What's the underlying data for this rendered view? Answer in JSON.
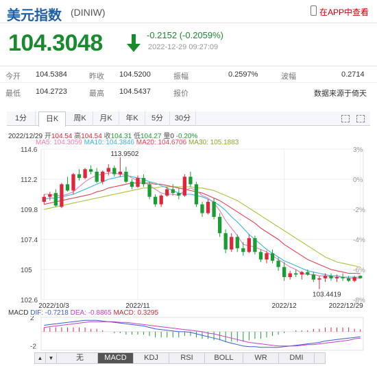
{
  "header": {
    "title": "美元指数",
    "code": "(DINIW)",
    "app_link": "在APP中查看"
  },
  "quote": {
    "price": "104.3048",
    "change": "-0.2152 (-0.2059%)",
    "time": "2022-12-29 09:27:09",
    "direction": "down",
    "color": "#1a8a2f"
  },
  "stats": {
    "open_label": "今开",
    "open": "104.5384",
    "prev_label": "昨收",
    "prev": "104.5200",
    "amp_label": "振幅",
    "amp": "0.2597%",
    "wave_label": "波幅",
    "wave": "0.2714",
    "low_label": "最低",
    "low": "104.2723",
    "high_label": "最高",
    "high": "104.5437",
    "report_label": "报价",
    "source": "数据来源于倚天"
  },
  "tabs": [
    "1分",
    "日K",
    "周K",
    "月K",
    "年K",
    "5分",
    "30分"
  ],
  "active_tab": "日K",
  "kinfo": {
    "date": "2022/12/29",
    "open_label": "开",
    "open": "104.54",
    "high_label": "高",
    "high": "104.54",
    "close_label": "收",
    "close": "104.31",
    "low_label": "低",
    "low": "104.27",
    "chg_label": "量",
    "chg": "0",
    "pct": "-0.20%"
  },
  "ma": {
    "ma5": "MA5: 104.3059",
    "ma10": "MA10: 104.3846",
    "ma20": "MA20: 104.6706",
    "ma30": "MA30: 105.1883"
  },
  "ma_colors": {
    "ma5": "#e87db8",
    "ma10": "#39b5e0",
    "ma20": "#e04055",
    "ma30": "#a8c23a"
  },
  "macd": {
    "label": "MACD",
    "dif": "DIF: -0.7218",
    "dea": "DEA: -0.8865",
    "macd": "MACD: 0.3295"
  },
  "buttons": [
    "无",
    "MACD",
    "KDJ",
    "RSI",
    "BOLL",
    "WR",
    "DMI"
  ],
  "active_button": "MACD",
  "chart_data": {
    "type": "candlestick",
    "y_ticks": [
      "114.6",
      "112.2",
      "109.8",
      "107.4",
      "105",
      "102.6"
    ],
    "pct_ticks": [
      "3%",
      "0%",
      "-2%",
      "-4%",
      "-6%",
      "-8%"
    ],
    "x_ticks": [
      "2022/10/3",
      "2022/11",
      "2022/12",
      "2022/12/29"
    ],
    "max_label": "113.9502",
    "min_label": "103.4419",
    "ylim": [
      102.6,
      114.6
    ],
    "up_color": "#e0263a",
    "down_color": "#1a9e33",
    "candles": [
      [
        110.4,
        111.0,
        110.2,
        110.8
      ],
      [
        110.8,
        111.2,
        110.5,
        111.0
      ],
      [
        111.1,
        111.4,
        110.0,
        110.1
      ],
      [
        110.0,
        111.9,
        109.9,
        111.8
      ],
      [
        111.8,
        112.4,
        111.2,
        111.3
      ],
      [
        111.3,
        112.7,
        111.0,
        112.6
      ],
      [
        112.6,
        113.0,
        112.1,
        112.3
      ],
      [
        112.3,
        113.1,
        112.2,
        113.0
      ],
      [
        113.0,
        113.3,
        112.6,
        112.8
      ],
      [
        112.8,
        113.1,
        111.9,
        112.0
      ],
      [
        112.0,
        112.9,
        111.8,
        112.8
      ],
      [
        112.8,
        113.4,
        112.5,
        113.1
      ],
      [
        113.1,
        113.3,
        112.4,
        112.6
      ],
      [
        112.6,
        113.95,
        112.4,
        112.8
      ],
      [
        112.8,
        113.2,
        111.9,
        112.0
      ],
      [
        112.0,
        112.2,
        111.4,
        111.6
      ],
      [
        111.6,
        112.5,
        111.5,
        112.3
      ],
      [
        112.3,
        112.6,
        111.6,
        111.8
      ],
      [
        111.8,
        112.0,
        110.6,
        110.8
      ],
      [
        110.8,
        111.0,
        110.0,
        110.2
      ],
      [
        110.2,
        111.0,
        110.0,
        110.9
      ],
      [
        110.9,
        111.6,
        110.8,
        111.4
      ],
      [
        111.4,
        111.8,
        110.9,
        111.1
      ],
      [
        111.1,
        111.5,
        110.6,
        110.9
      ],
      [
        110.9,
        112.6,
        110.8,
        112.4
      ],
      [
        112.4,
        112.8,
        111.6,
        111.8
      ],
      [
        111.8,
        112.0,
        110.0,
        110.2
      ],
      [
        110.2,
        110.4,
        109.2,
        109.5
      ],
      [
        109.5,
        110.6,
        109.4,
        110.4
      ],
      [
        110.4,
        110.7,
        109.0,
        109.2
      ],
      [
        109.2,
        109.5,
        107.6,
        107.9
      ],
      [
        107.9,
        108.2,
        106.3,
        106.6
      ],
      [
        106.6,
        107.9,
        106.4,
        107.6
      ],
      [
        107.6,
        107.8,
        106.4,
        106.7
      ],
      [
        106.7,
        107.2,
        106.1,
        106.4
      ],
      [
        106.4,
        107.8,
        106.3,
        107.5
      ],
      [
        107.5,
        107.7,
        106.2,
        106.4
      ],
      [
        106.4,
        106.6,
        105.6,
        105.8
      ],
      [
        105.8,
        106.5,
        105.5,
        106.3
      ],
      [
        106.3,
        106.6,
        105.5,
        105.7
      ],
      [
        105.7,
        106.0,
        104.9,
        105.2
      ],
      [
        105.2,
        105.6,
        104.1,
        104.4
      ],
      [
        104.4,
        104.9,
        104.2,
        104.7
      ],
      [
        104.7,
        105.0,
        104.4,
        104.6
      ],
      [
        104.6,
        104.9,
        104.2,
        104.8
      ],
      [
        104.8,
        105.0,
        104.5,
        104.6
      ],
      [
        104.6,
        104.8,
        104.0,
        104.2
      ],
      [
        104.2,
        104.5,
        103.44,
        104.3
      ],
      [
        104.3,
        104.7,
        104.0,
        104.5
      ],
      [
        104.5,
        104.7,
        104.1,
        104.3
      ],
      [
        104.3,
        104.6,
        104.0,
        104.4
      ],
      [
        104.4,
        104.7,
        104.1,
        104.3
      ],
      [
        104.3,
        104.5,
        104.0,
        104.1
      ],
      [
        104.1,
        104.5,
        104.0,
        104.4
      ],
      [
        104.5,
        104.54,
        104.27,
        104.31
      ]
    ],
    "ma5": [
      111.0,
      111.0,
      110.9,
      110.9,
      111.0,
      111.2,
      111.6,
      112.0,
      112.3,
      112.5,
      112.6,
      112.7,
      112.7,
      112.6,
      112.6,
      112.3,
      112.1,
      112.0,
      111.7,
      111.4,
      111.1,
      111.0,
      111.0,
      110.9,
      111.3,
      111.5,
      111.3,
      110.9,
      110.7,
      110.3,
      109.7,
      108.9,
      108.3,
      107.7,
      107.0,
      106.9,
      106.8,
      106.6,
      106.4,
      106.1,
      105.8,
      105.5,
      105.2,
      105.0,
      104.7,
      104.6,
      104.6,
      104.5,
      104.5,
      104.4,
      104.4,
      104.4,
      104.3,
      104.3,
      104.3
    ],
    "ma10": [
      110.6,
      110.7,
      110.7,
      110.8,
      110.9,
      111.0,
      111.2,
      111.4,
      111.6,
      111.8,
      112.0,
      112.2,
      112.3,
      112.4,
      112.5,
      112.4,
      112.3,
      112.2,
      112.0,
      111.9,
      111.7,
      111.5,
      111.3,
      111.1,
      111.0,
      111.0,
      110.9,
      110.8,
      110.6,
      110.4,
      110.1,
      109.7,
      109.2,
      108.8,
      108.3,
      107.8,
      107.4,
      107.0,
      106.6,
      106.3,
      106.0,
      105.7,
      105.5,
      105.3,
      105.1,
      104.9,
      104.8,
      104.7,
      104.6,
      104.5,
      104.5,
      104.4,
      104.4,
      104.4,
      104.4
    ],
    "ma20": [
      110.2,
      110.3,
      110.4,
      110.5,
      110.6,
      110.7,
      110.8,
      110.9,
      111.0,
      111.2,
      111.3,
      111.5,
      111.6,
      111.7,
      111.8,
      111.9,
      111.9,
      111.9,
      111.9,
      111.8,
      111.8,
      111.7,
      111.6,
      111.5,
      111.4,
      111.3,
      111.2,
      111.1,
      110.9,
      110.7,
      110.5,
      110.2,
      109.9,
      109.6,
      109.3,
      109.0,
      108.7,
      108.3,
      108.0,
      107.7,
      107.4,
      107.0,
      106.7,
      106.4,
      106.1,
      105.8,
      105.6,
      105.4,
      105.2,
      105.0,
      104.9,
      104.8,
      104.7,
      104.7,
      104.67
    ],
    "ma30": [
      109.8,
      109.9,
      110.0,
      110.1,
      110.2,
      110.3,
      110.4,
      110.5,
      110.6,
      110.7,
      110.8,
      110.9,
      111.0,
      111.1,
      111.2,
      111.3,
      111.4,
      111.5,
      111.5,
      111.5,
      111.6,
      111.6,
      111.6,
      111.6,
      111.6,
      111.6,
      111.5,
      111.5,
      111.4,
      111.3,
      111.1,
      110.9,
      110.7,
      110.5,
      110.2,
      109.9,
      109.6,
      109.3,
      109.0,
      108.7,
      108.4,
      108.1,
      107.8,
      107.5,
      107.2,
      106.9,
      106.6,
      106.3,
      106.0,
      105.8,
      105.6,
      105.5,
      105.4,
      105.3,
      105.19
    ],
    "macd_dif": [
      0.9,
      1.0,
      1.1,
      1.2,
      1.3,
      1.4,
      1.5,
      1.6,
      1.6,
      1.6,
      1.5,
      1.4,
      1.3,
      1.2,
      1.1,
      1.0,
      0.9,
      0.8,
      0.6,
      0.4,
      0.3,
      0.2,
      0.1,
      0.0,
      0.0,
      -0.1,
      -0.3,
      -0.5,
      -0.7,
      -0.9,
      -1.1,
      -1.4,
      -1.6,
      -1.8,
      -2.0,
      -2.1,
      -2.1,
      -2.2,
      -2.2,
      -2.2,
      -2.2,
      -2.1,
      -2.0,
      -1.9,
      -1.8,
      -1.7,
      -1.6,
      -1.5,
      -1.3,
      -1.2,
      -1.1,
      -1.0,
      -0.9,
      -0.8,
      -0.72
    ],
    "macd_dea": [
      0.6,
      0.7,
      0.8,
      0.9,
      1.0,
      1.1,
      1.2,
      1.3,
      1.4,
      1.4,
      1.4,
      1.4,
      1.4,
      1.3,
      1.3,
      1.2,
      1.1,
      1.0,
      0.9,
      0.8,
      0.7,
      0.6,
      0.5,
      0.4,
      0.3,
      0.2,
      0.1,
      0.0,
      -0.2,
      -0.3,
      -0.5,
      -0.7,
      -0.9,
      -1.1,
      -1.3,
      -1.5,
      -1.6,
      -1.7,
      -1.8,
      -1.9,
      -2.0,
      -2.0,
      -2.0,
      -2.0,
      -1.9,
      -1.8,
      -1.8,
      -1.7,
      -1.6,
      -1.5,
      -1.4,
      -1.3,
      -1.2,
      -1.0,
      -0.89
    ],
    "macd_ylim": [
      -2.6,
      2.0
    ]
  }
}
